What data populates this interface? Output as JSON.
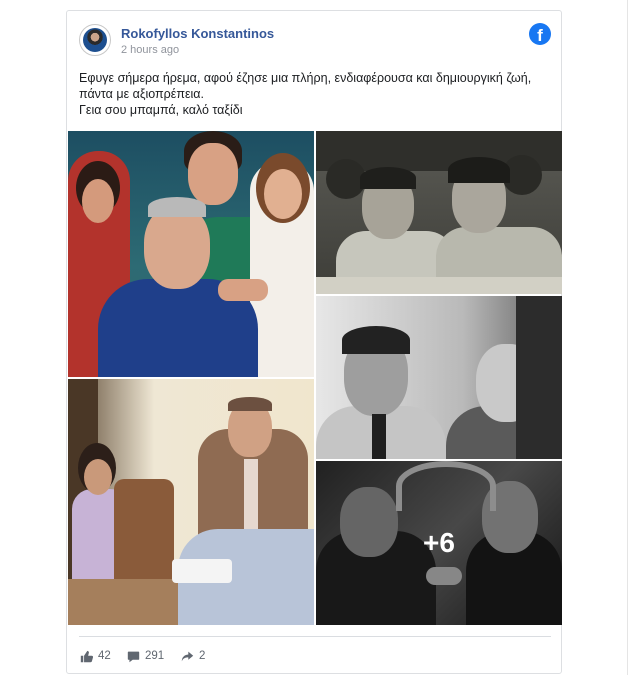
{
  "post": {
    "author": "Rokofyllos Konstantinos",
    "timestamp": "2 hours ago",
    "text_lines": [
      "Εφυγε σήμερα ήρεμα, αφού έζησε μια πλήρη, ενδιαφέρουσα και δημιουργική ζωή,",
      "πάντα με αξιοπρέπεια.",
      "Γεια σου μπαμπά, καλό ταξίδι"
    ],
    "more_photos_label": "+6"
  },
  "stats": {
    "likes": "42",
    "comments": "291",
    "shares": "2"
  },
  "icons": {
    "brand": "facebook-icon",
    "like": "thumbs-up-icon",
    "comment": "comment-icon",
    "share": "share-icon"
  },
  "colors": {
    "author_link": "#365899",
    "facebook_blue": "#1877f2",
    "meta_gray": "#90949c"
  }
}
